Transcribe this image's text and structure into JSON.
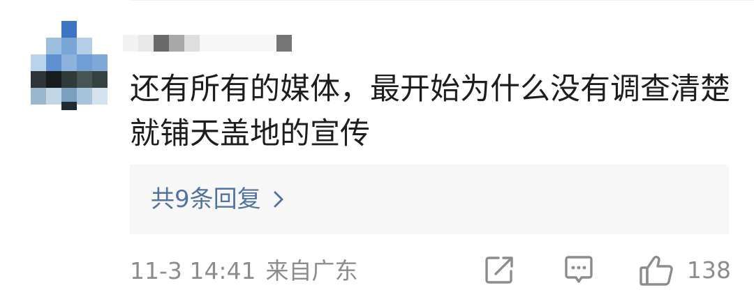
{
  "comment": {
    "text": "还有所有的媒体，最开始为什么没有调查清楚就铺天盖地的宣传",
    "replies_label": "共9条回复",
    "timestamp": "11-3 14:41",
    "location": "来自广东",
    "like_count": "138"
  },
  "icons": {
    "share": "share-icon",
    "comment": "comment-icon",
    "like": "thumbs-up-icon",
    "replies_chevron": "chevron-right-icon"
  },
  "colors": {
    "text": "#1d1d1d",
    "link": "#51739d",
    "meta": "#8c8c8c",
    "reply_box_bg": "#f7f7f7"
  }
}
